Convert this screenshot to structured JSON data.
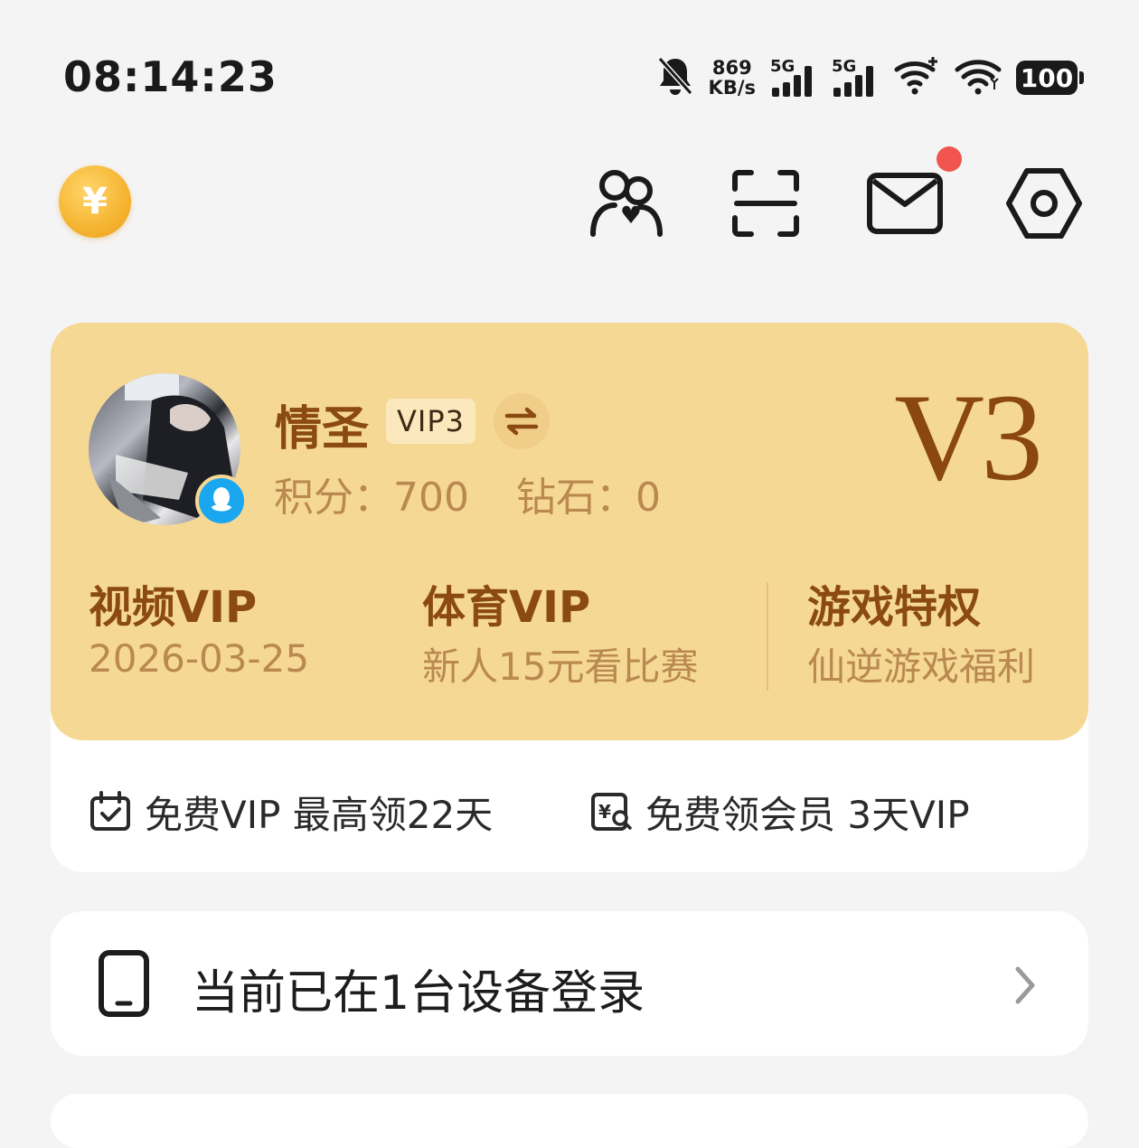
{
  "status_bar": {
    "time": "08:14:23",
    "net_speed_value": "869",
    "net_speed_unit": "KB/s",
    "sim1_label": "5G",
    "sim2_label": "5G",
    "battery": "100",
    "icons": [
      "bell-muted-icon",
      "signal-icon",
      "signal-icon",
      "wifi-plus-icon",
      "wifi-icon",
      "battery-icon"
    ]
  },
  "header": {
    "coin_symbol": "¥",
    "icons": [
      "coin-icon",
      "friends-icon",
      "scan-icon",
      "mail-icon",
      "settings-icon"
    ]
  },
  "profile": {
    "name": "情圣",
    "vip_tag": "VIP3",
    "points": "积分：700",
    "diamonds": "钻石：0",
    "level": "V3"
  },
  "vip_items": [
    {
      "title": "视频VIP",
      "subtitle": "2026-03-25"
    },
    {
      "title": "体育VIP",
      "subtitle": "新人15元看比赛"
    },
    {
      "title": "游戏特权",
      "subtitle": "仙逆游戏福利"
    }
  ],
  "promos": [
    {
      "label": "免费VIP 最高领22天",
      "icon": "calendar-check-icon"
    },
    {
      "label": "免费领会员 3天VIP",
      "icon": "coupon-search-icon"
    }
  ],
  "device": {
    "label": "当前已在1台设备登录",
    "icon": "phone-icon"
  },
  "colors": {
    "card_gold": "#f6d895",
    "title_brown": "#8a4a12",
    "sub_brown": "#b9894f",
    "badge_red": "#f2544f",
    "qq_blue": "#1aa7f0"
  }
}
